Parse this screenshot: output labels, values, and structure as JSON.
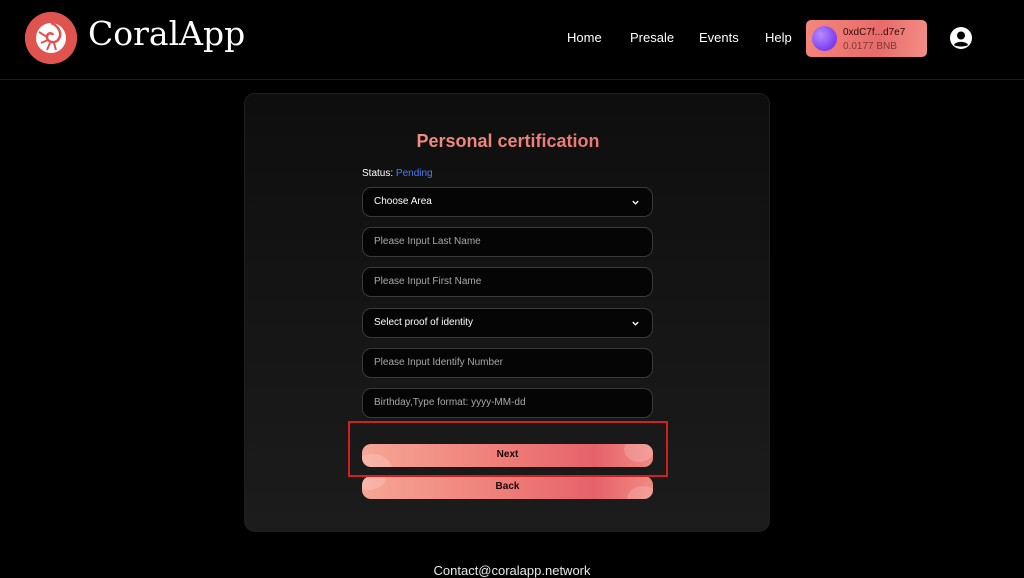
{
  "header": {
    "brand": "CoralApp",
    "nav": [
      {
        "label": "Home"
      },
      {
        "label": "Presale"
      },
      {
        "label": "Events"
      },
      {
        "label": "Help"
      }
    ],
    "wallet": {
      "address": "0xdC7f...d7e7",
      "balance": "0.0177 BNB"
    },
    "icons": {
      "logo": "coral-shell-logo",
      "user": "user-circle-icon"
    }
  },
  "form": {
    "title": "Personal certification",
    "status_label": "Status:",
    "status_value": "Pending",
    "area_select": "Choose Area",
    "last_name_placeholder": "Please Input Last Name",
    "first_name_placeholder": "Please Input First Name",
    "identity_select": "Select proof of identity",
    "id_number_placeholder": "Please Input Identify Number",
    "birthday_placeholder": "Birthday,Type format: yyyy-MM-dd",
    "next_label": "Next",
    "back_label": "Back"
  },
  "footer": {
    "contact": "Contact@coralapp.network"
  },
  "colors": {
    "accent": "#e86b6a",
    "status": "#4d7cf7",
    "highlight": "#d21f1f",
    "background": "#000000"
  }
}
